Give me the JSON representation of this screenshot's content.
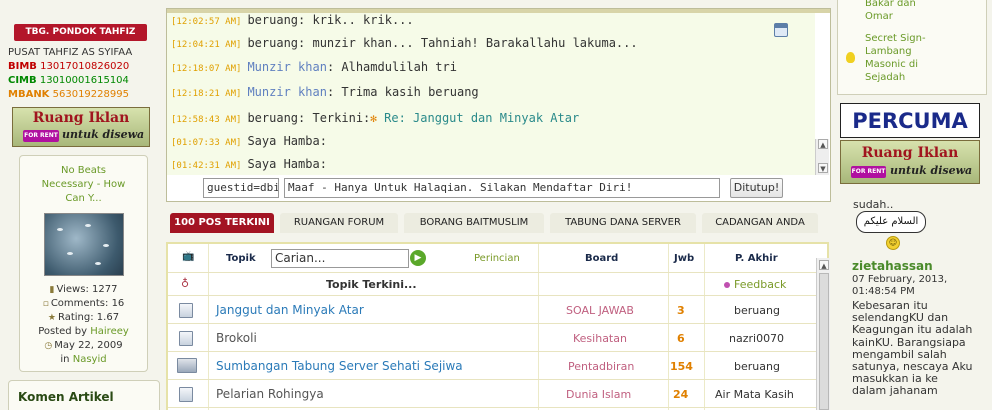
{
  "left": {
    "badge": "TBG. PONDOK TAHFIZ",
    "pusat": "PUSAT TAHFIZ AS SYIFAA",
    "banks": [
      {
        "name": "BIMB",
        "number": "13017010826020"
      },
      {
        "name": "CIMB",
        "number": "13010001615104"
      },
      {
        "name": "MBANK",
        "number": "563019228995"
      }
    ],
    "ad": {
      "title": "Ruang Iklan",
      "forrent": "FOR RENT",
      "untuk": "untuk disewa"
    },
    "video": {
      "title_lines": [
        "No Beats",
        "Necessary - How",
        "Can Y..."
      ],
      "views": "Views: 1277",
      "comments": "Comments: 16",
      "rating": "Rating: 1.67",
      "posted_by": "Posted by",
      "user": "Haireey",
      "date": "May 22, 2009",
      "in_label": "in",
      "category": "Nasyid"
    },
    "komen_title": "Komen Artikel"
  },
  "chat": {
    "rows": [
      {
        "ts": "[12:02:57 AM]",
        "name": "beruang",
        "msg": ": krik.. krik...",
        "alt": false
      },
      {
        "ts": "[12:04:21 AM]",
        "name": "beruang",
        "msg": ": munzir khan... Tahniah! Barakallahu lakuma...",
        "alt": false
      },
      {
        "ts": "[12:18:07 AM]",
        "name": "Munzir khan",
        "msg": ": Alhamdulilah tri",
        "alt": true
      },
      {
        "ts": "[12:18:21 AM]",
        "name": "Munzir khan",
        "msg": ": Trima kasih beruang",
        "alt": true
      },
      {
        "ts": "[12:58:43 AM]",
        "name": "beruang",
        "msg": ": Terkini:",
        "link": "Re: Janggut dan Minyak Atar",
        "alt": false
      },
      {
        "ts": "[01:07:33 AM]",
        "name": "Saya Hamba",
        "msg": ":",
        "alt": false
      },
      {
        "ts": "[01:42:31 AM]",
        "name": "Saya Hamba",
        "msg": ":",
        "alt": false
      }
    ],
    "guest_value": "guestid=dbi",
    "message_value": "Maaf - Hanya Untuk Halaqian. Silakan Mendaftar Diri!",
    "close_button": "Ditutup!"
  },
  "tabs": [
    "100 POS TERKINI",
    "RUANGAN FORUM",
    "BORANG BAITMUSLIM",
    "TABUNG DANA SERVER",
    "CADANGAN ANDA"
  ],
  "table": {
    "headers": {
      "topik": "Topik",
      "perincian": "Perincian",
      "board": "Board",
      "jwb": "Jwb",
      "akhir": "P. Akhir"
    },
    "search_placeholder": "Carian...",
    "go": "▶",
    "subheader": "Topik Terkini...",
    "feedback": "Feedback",
    "rows": [
      {
        "title": "Janggut dan Minyak Atar",
        "board": "SOAL JAWAB",
        "jwb": "3",
        "akhir": "beruang",
        "plain": false
      },
      {
        "title": "Brokoli",
        "board": "Kesihatan",
        "jwb": "6",
        "akhir": "nazri0070",
        "plain": true
      },
      {
        "title": "Sumbangan Tabung Server Sehati Sejiwa",
        "board": "Pentadbiran",
        "jwb": "154",
        "akhir": "beruang",
        "plain": false
      },
      {
        "title": "Pelarian Rohingya",
        "board": "Dunia Islam",
        "jwb": "24",
        "akhir": "Air Mata Kasih",
        "plain": true
      }
    ]
  },
  "right": {
    "link1_lines": [
      "Bakar dan",
      "Omar"
    ],
    "link2_lines": [
      "Secret Sign-",
      "Lambang",
      "Masonic di",
      "Sejadah"
    ],
    "percuma": "PERCUMA",
    "ad": {
      "title": "Ruang Iklan",
      "forrent": "FOR RENT",
      "untuk": "untuk disewa"
    },
    "sudah": "sudah..",
    "arabic": "السلام عليكم",
    "user": "zietahassan",
    "date_line1": "07 February, 2013,",
    "date_line2": "01:48:54 PM",
    "message": "Kebesaran itu selendangKU dan Keagungan itu adalah kainKU. Barangsiapa mengambil salah satunya, nescaya Aku masukkan ia ke dalam jahanam"
  },
  "colors": {
    "accent": "#a31423",
    "green_link": "#6a9a28",
    "blue_link": "#2a7ab8",
    "orange": "#e08000"
  }
}
